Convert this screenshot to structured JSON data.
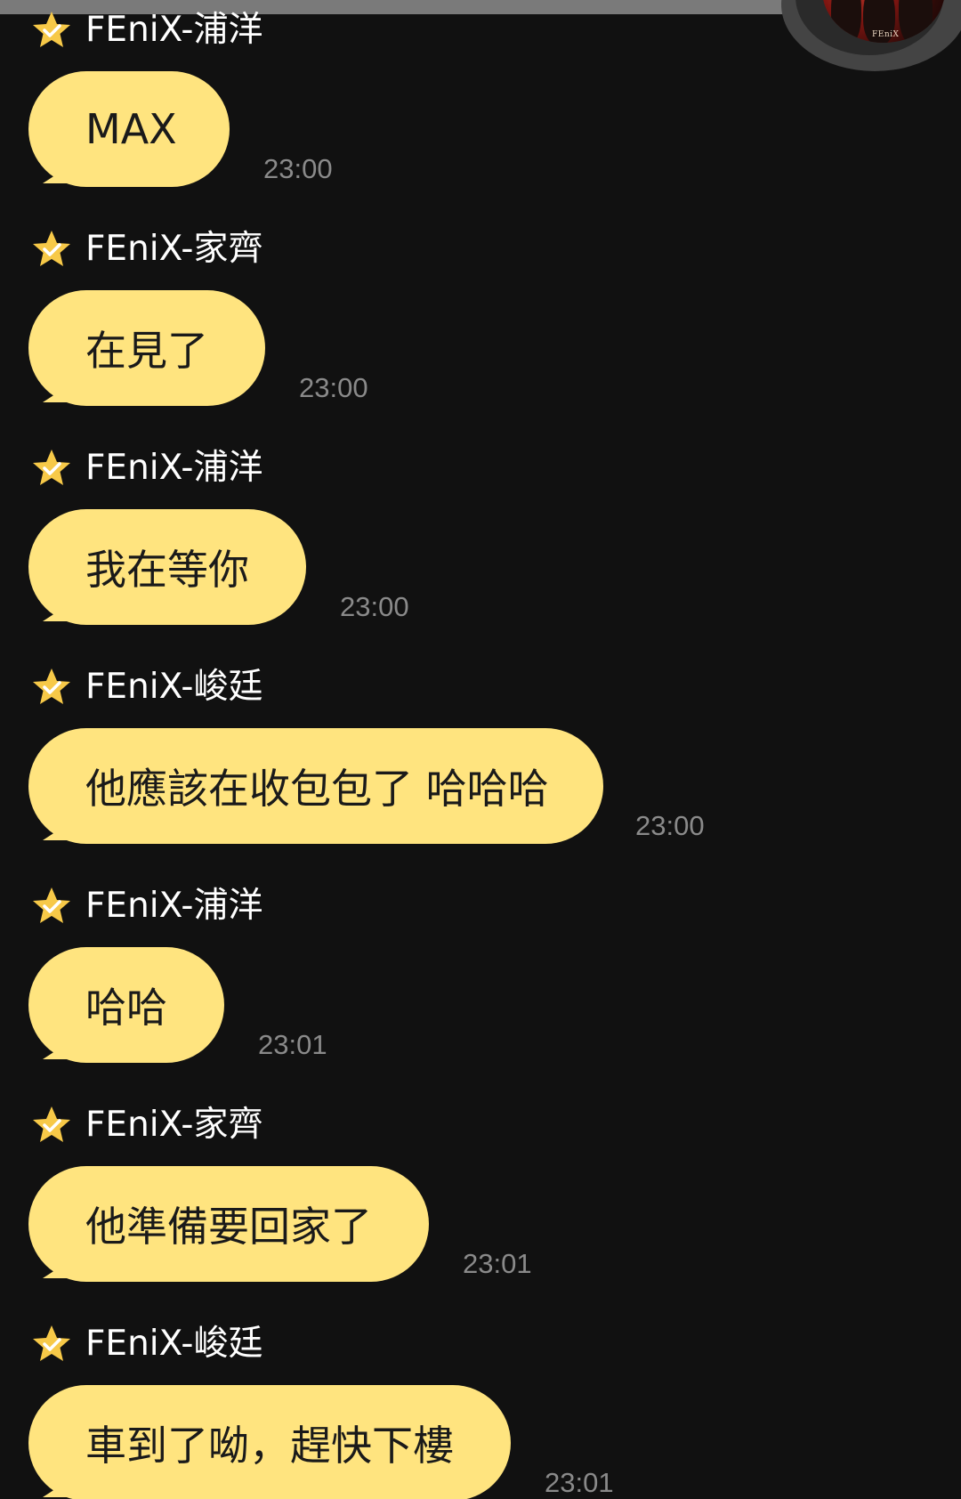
{
  "theme": {
    "bubble_color": "#ffe47f",
    "background_color": "#111111",
    "star_color": "#f7c948"
  },
  "header": {
    "avatar_logo_text": "FEniX"
  },
  "messages": [
    {
      "sender": "FEniX-浦洋",
      "text": "MAX",
      "time": "23:00"
    },
    {
      "sender": "FEniX-家齊",
      "text": "在見了",
      "time": "23:00"
    },
    {
      "sender": "FEniX-浦洋",
      "text": "我在等你",
      "time": "23:00"
    },
    {
      "sender": "FEniX-峻廷",
      "text": "他應該在收包包了 哈哈哈",
      "time": "23:00"
    },
    {
      "sender": "FEniX-浦洋",
      "text": "哈哈",
      "time": "23:01"
    },
    {
      "sender": "FEniX-家齊",
      "text": "他準備要回家了",
      "time": "23:01"
    },
    {
      "sender": "FEniX-峻廷",
      "text": "車到了呦，趕快下樓",
      "time": "23:01"
    }
  ]
}
